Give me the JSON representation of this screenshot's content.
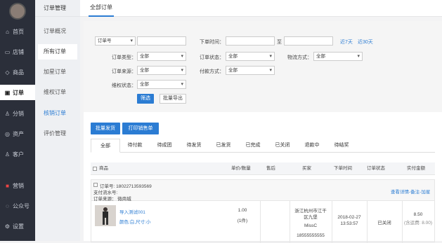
{
  "sidebar": {
    "items": [
      {
        "label": "首页",
        "icon": "home-icon",
        "glyph": "⌂"
      },
      {
        "label": "店铺",
        "icon": "shop-icon",
        "glyph": "▭"
      },
      {
        "label": "商品",
        "icon": "tag-icon",
        "glyph": "◇"
      },
      {
        "label": "订单",
        "icon": "order-icon",
        "glyph": "▣"
      },
      {
        "label": "分销",
        "icon": "user-icon",
        "glyph": "♙"
      },
      {
        "label": "资产",
        "icon": "asset-icon",
        "glyph": "◎"
      },
      {
        "label": "客户",
        "icon": "customer-icon",
        "glyph": "♙"
      },
      {
        "label": "营销",
        "icon": "marketing-icon",
        "glyph": "■"
      },
      {
        "label": "公众号",
        "icon": "wechat-icon",
        "glyph": "◌"
      },
      {
        "label": "设置",
        "icon": "settings-icon",
        "glyph": "⚙"
      }
    ]
  },
  "subnav": {
    "title": "订单管理",
    "items": [
      {
        "label": "订单概况"
      },
      {
        "label": "所有订单"
      },
      {
        "label": "加星订单"
      },
      {
        "label": "维权订单"
      },
      {
        "label": "核销订单"
      },
      {
        "label": "评价管理"
      }
    ]
  },
  "topbar": {
    "tab": "全部订单"
  },
  "filter": {
    "order_no_select": "订单号",
    "order_time_label": "下单时间：",
    "to_label": "至",
    "last7": "近7天",
    "last30": "近30天",
    "order_type_label": "订单类型：",
    "order_type_value": "全部",
    "order_status_label": "订单状态：",
    "order_status_value": "全部",
    "logistics_label": "物流方式：",
    "logistics_value": "全部",
    "order_source_label": "订单来源：",
    "order_source_value": "全部",
    "payment_label": "付款方式：",
    "payment_value": "全部",
    "rights_label": "维权状态：",
    "rights_value": "全部",
    "filter_button": "筛选",
    "export_button": "批量导出"
  },
  "actions": {
    "batch_ship": "批量发货",
    "print": "打印销售单"
  },
  "status_tabs": [
    "全部",
    "待付款",
    "待成团",
    "待发货",
    "已发货",
    "已完成",
    "已关闭",
    "退款中",
    "待结奖"
  ],
  "table": {
    "headers": [
      "商品",
      "单价/数量",
      "售后",
      "买家",
      "下单时间",
      "订单状态",
      "实付金额"
    ],
    "order": {
      "order_no": "订单号: 18022713593569",
      "serial": "支付流水号:",
      "source": "订单来源：   微商城",
      "detail_link": "查看详情-备注-加星",
      "product_name": "导入测试001",
      "product_spec": "颜色:白,尺寸:小",
      "price": "1.00",
      "qty": "(1件)",
      "buyer_addr1": "浙江杭州市江干",
      "buyer_addr2": "区九堡",
      "buyer_name": "MissC",
      "buyer_phone": "18555555555",
      "date": "2018-02-27",
      "time": "13:53:57",
      "status": "已关闭",
      "amount": "8.50",
      "shipping": "(含运费: 8.00)"
    }
  }
}
